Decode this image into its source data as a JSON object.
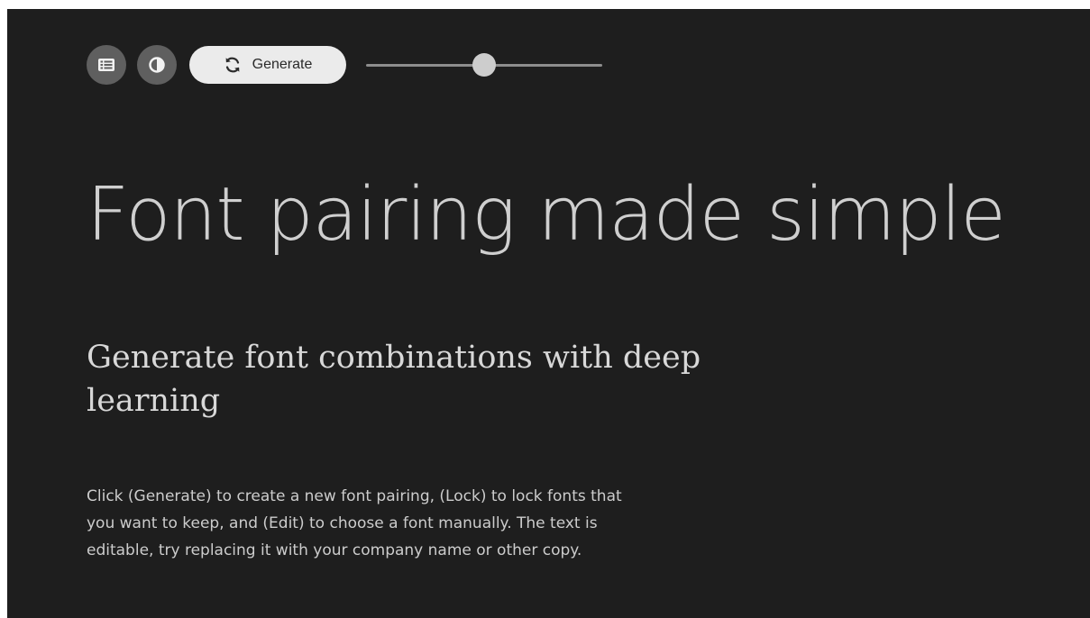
{
  "toolbar": {
    "list_icon": "list-icon",
    "theme_icon": "contrast-icon",
    "generate_icon": "refresh-icon",
    "generate_label": "Generate",
    "slider_value": 0.5
  },
  "main": {
    "heading": "Font pairing made simple",
    "subheading": "Generate font combinations with deep learning",
    "description": "Click (Generate) to create a new font pairing, (Lock) to lock fonts that you want to keep, and (Edit) to choose a font manually. The text is editable, try replacing it with your company name or other copy."
  },
  "colors": {
    "background": "#1e1e1e",
    "icon_button": "#5f5f5f",
    "generate_button": "#ebebeb",
    "text": "#cfcfcf"
  }
}
